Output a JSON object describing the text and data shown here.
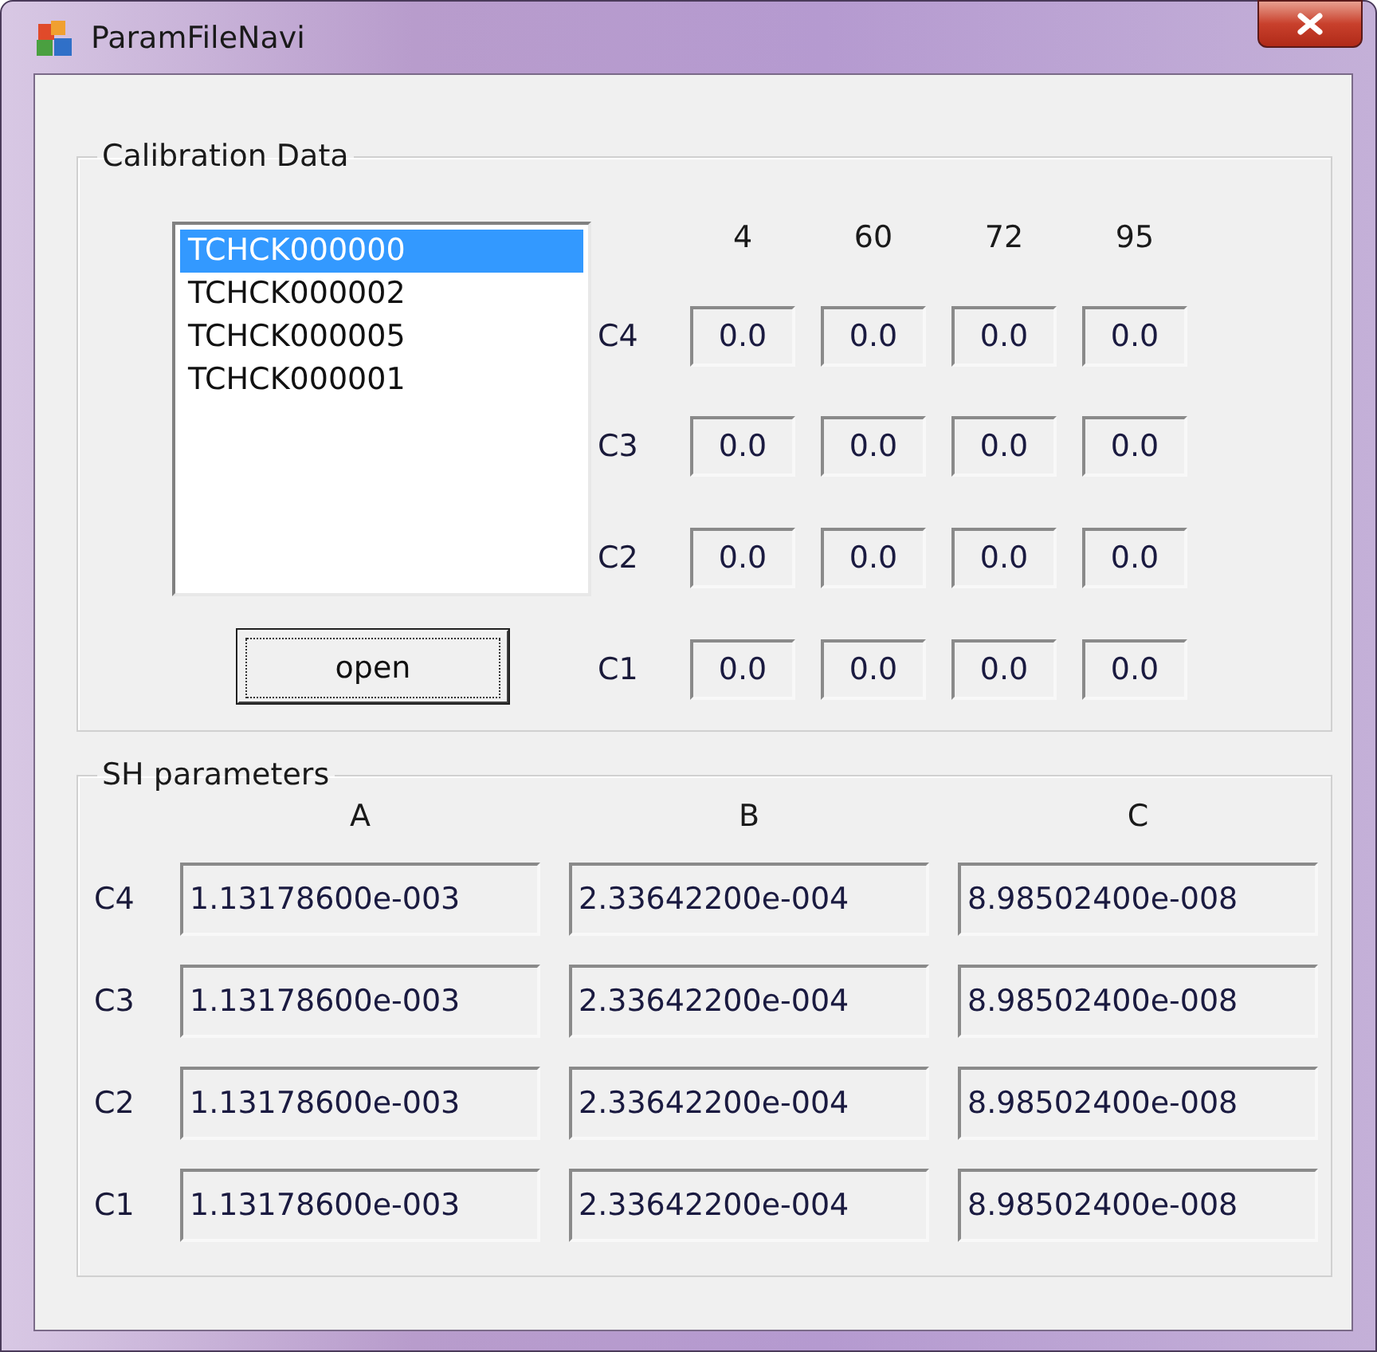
{
  "window": {
    "title": "ParamFileNavi"
  },
  "calibration": {
    "title": "Calibration Data",
    "files": [
      {
        "label": "TCHCK000000",
        "selected": true
      },
      {
        "label": "TCHCK000002",
        "selected": false
      },
      {
        "label": "TCHCK000005",
        "selected": false
      },
      {
        "label": "TCHCK000001",
        "selected": false
      }
    ],
    "open_button": "open",
    "columns": [
      "4",
      "60",
      "72",
      "95"
    ],
    "rows": [
      {
        "label": "C4",
        "values": [
          "0.0",
          "0.0",
          "0.0",
          "0.0"
        ]
      },
      {
        "label": "C3",
        "values": [
          "0.0",
          "0.0",
          "0.0",
          "0.0"
        ]
      },
      {
        "label": "C2",
        "values": [
          "0.0",
          "0.0",
          "0.0",
          "0.0"
        ]
      },
      {
        "label": "C1",
        "values": [
          "0.0",
          "0.0",
          "0.0",
          "0.0"
        ]
      }
    ]
  },
  "sh_parameters": {
    "title": "SH parameters",
    "columns": [
      "A",
      "B",
      "C"
    ],
    "rows": [
      {
        "label": "C4",
        "values": [
          "1.13178600e-003",
          "2.33642200e-004",
          "8.98502400e-008"
        ]
      },
      {
        "label": "C3",
        "values": [
          "1.13178600e-003",
          "2.33642200e-004",
          "8.98502400e-008"
        ]
      },
      {
        "label": "C2",
        "values": [
          "1.13178600e-003",
          "2.33642200e-004",
          "8.98502400e-008"
        ]
      },
      {
        "label": "C1",
        "values": [
          "1.13178600e-003",
          "2.33642200e-004",
          "8.98502400e-008"
        ]
      }
    ]
  }
}
